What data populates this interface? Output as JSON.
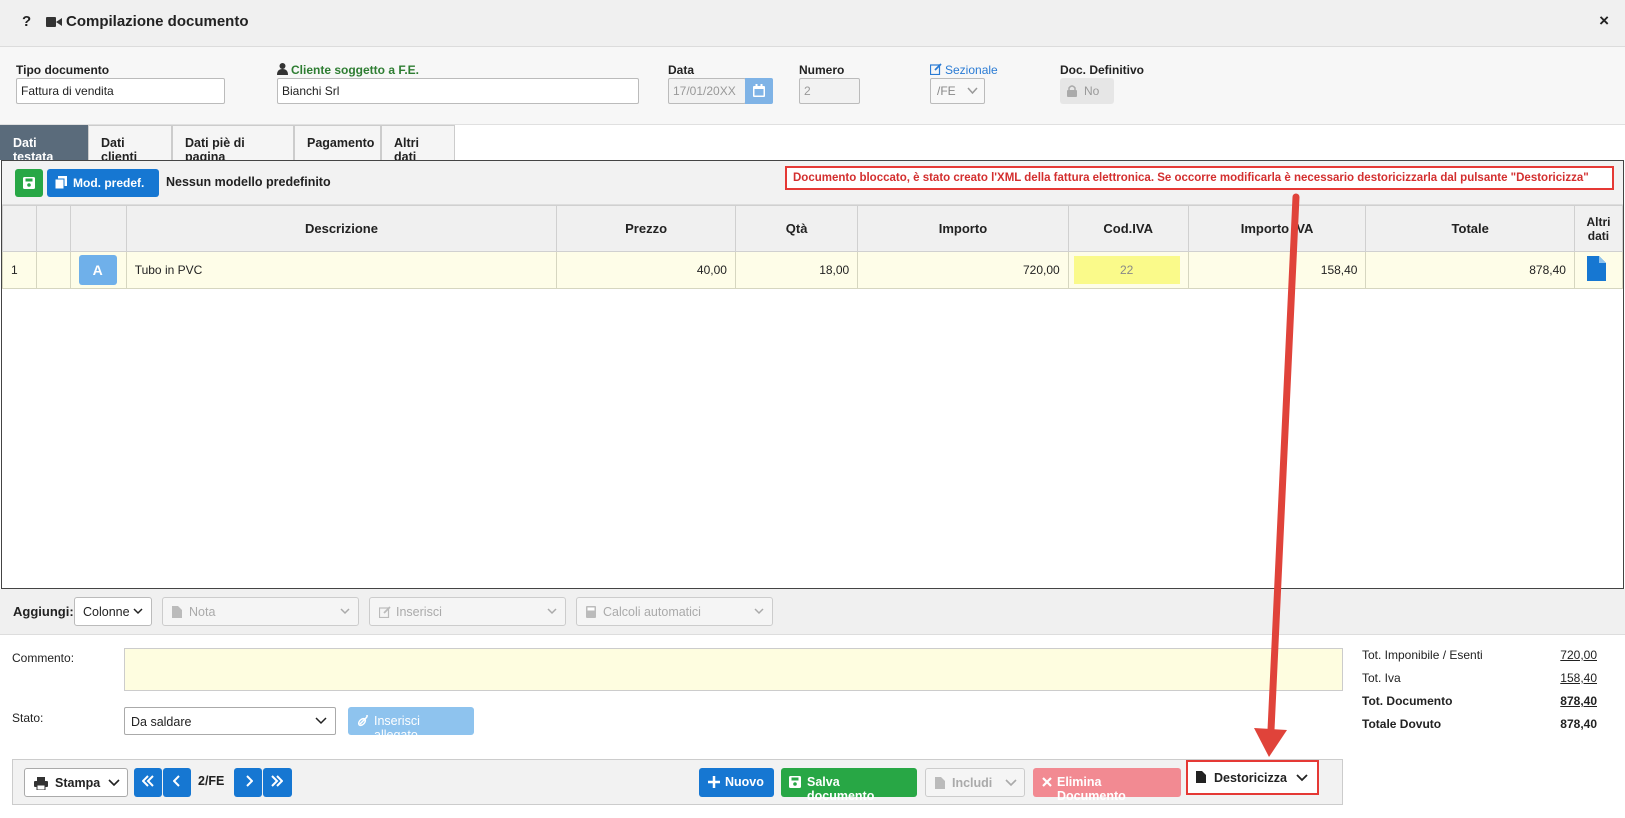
{
  "window": {
    "help": "?",
    "title": "Compilazione documento",
    "close": "×"
  },
  "form": {
    "tipo_label": "Tipo documento",
    "tipo_value": "Fattura di vendita",
    "cliente_label": "Cliente soggetto a F.E.",
    "cliente_value": "Bianchi Srl",
    "data_label": "Data",
    "data_value": "17/01/20XX",
    "numero_label": "Numero",
    "numero_value": "2",
    "sezionale_label": "Sezionale",
    "sezionale_value": "/FE",
    "definitivo_label": "Doc. Definitivo",
    "definitivo_value": "No"
  },
  "tabs": [
    "Dati testata",
    "Dati clienti",
    "Dati piè di pagina",
    "Pagamento",
    "Altri dati"
  ],
  "toolbar": {
    "mod_label": "Mod. predef.",
    "no_model": "Nessun modello predefinito",
    "warning": "Documento bloccato, è stato creato l'XML della fattura elettronica. Se occorre modificarla è necessario destoricizzarla dal pulsante \"Destoricizza\""
  },
  "table": {
    "headers": [
      "Descrizione",
      "Prezzo",
      "Qtà",
      "Importo",
      "Cod.IVA",
      "Importo IVA",
      "Totale",
      "Altri dati"
    ],
    "rows": [
      {
        "n": "1",
        "badge": "A",
        "descrizione": "Tubo in PVC",
        "prezzo": "40,00",
        "qta": "18,00",
        "importo": "720,00",
        "iva": "22",
        "importo_iva": "158,40",
        "totale": "878,40"
      }
    ]
  },
  "addbar": {
    "label": "Aggiungi:",
    "colonne": "Colonne",
    "nota": "Nota",
    "inserisci": "Inserisci",
    "calcoli": "Calcoli automatici"
  },
  "comment": {
    "label": "Commento:",
    "value": ""
  },
  "stato": {
    "label": "Stato:",
    "value": "Da saldare",
    "allegato": "Inserisci allegato"
  },
  "totals": [
    {
      "k": "Tot. Imponibile / Esenti",
      "v": "720,00"
    },
    {
      "k": "Tot. Iva",
      "v": "158,40"
    },
    {
      "k": "Tot. Documento",
      "v": "878,40"
    },
    {
      "k": "Totale Dovuto",
      "v": "878,40"
    }
  ],
  "footer": {
    "stampa": "Stampa",
    "pager": "2/FE",
    "nuovo": "Nuovo",
    "salva": "Salva documento",
    "includi": "Includi",
    "elimina": "Elimina Documento",
    "destoricizza": "Destoricizza"
  },
  "colors": {
    "accent_blue": "#1677d2",
    "green": "#28a745",
    "warning_red": "#e53935",
    "active_tab": "#5a6b7b"
  }
}
